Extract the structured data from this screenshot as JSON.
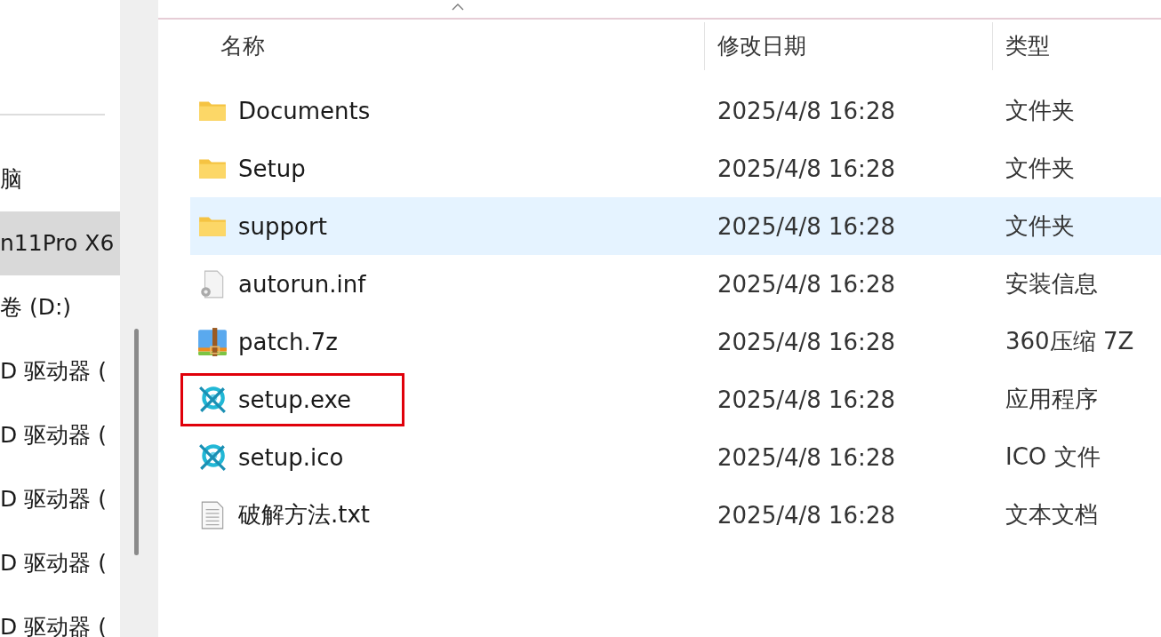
{
  "sidebar": {
    "items": [
      {
        "label": "脑",
        "selected": false
      },
      {
        "label": "n11Pro X6",
        "selected": true
      },
      {
        "label": "卷 (D:)",
        "selected": false
      },
      {
        "label": "D 驱动器 (",
        "selected": false
      },
      {
        "label": "D 驱动器 (",
        "selected": false
      },
      {
        "label": "D 驱动器 (",
        "selected": false
      },
      {
        "label": "D 驱动器 (",
        "selected": false
      },
      {
        "label": "D 驱动器 (",
        "selected": false
      }
    ]
  },
  "table": {
    "columns": [
      "名称",
      "修改日期",
      "类型"
    ],
    "rows": [
      {
        "name": "Documents",
        "date": "2025/4/8 16:28",
        "type": "文件夹",
        "kind": "folder",
        "selected": false,
        "highlighted": false
      },
      {
        "name": "Setup",
        "date": "2025/4/8 16:28",
        "type": "文件夹",
        "kind": "folder",
        "selected": false,
        "highlighted": false
      },
      {
        "name": "support",
        "date": "2025/4/8 16:28",
        "type": "文件夹",
        "kind": "folder",
        "selected": true,
        "highlighted": false
      },
      {
        "name": "autorun.inf",
        "date": "2025/4/8 16:28",
        "type": "安装信息",
        "kind": "settings",
        "selected": false,
        "highlighted": false
      },
      {
        "name": "patch.7z",
        "date": "2025/4/8 16:28",
        "type": "360压缩 7Z",
        "kind": "archive",
        "selected": false,
        "highlighted": false
      },
      {
        "name": "setup.exe",
        "date": "2025/4/8 16:28",
        "type": "应用程序",
        "kind": "app",
        "selected": false,
        "highlighted": true
      },
      {
        "name": "setup.ico",
        "date": "2025/4/8 16:28",
        "type": "ICO 文件",
        "kind": "app",
        "selected": false,
        "highlighted": false
      },
      {
        "name": "破解方法.txt",
        "date": "2025/4/8 16:28",
        "type": "文本文档",
        "kind": "text",
        "selected": false,
        "highlighted": false
      }
    ]
  }
}
